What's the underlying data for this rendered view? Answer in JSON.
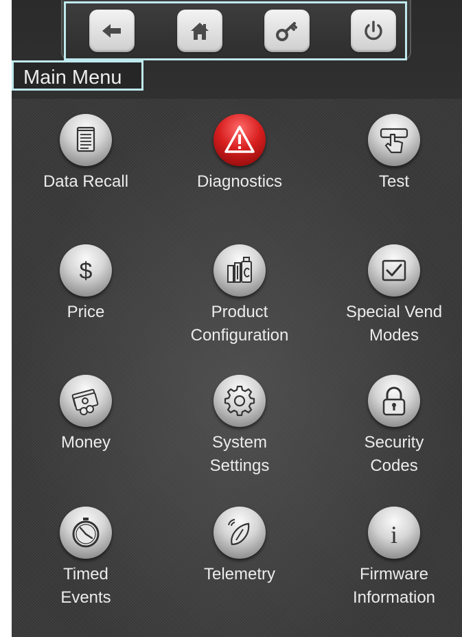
{
  "toolbar": {
    "buttons": [
      {
        "name": "back",
        "icon": "arrow-left-icon"
      },
      {
        "name": "home",
        "icon": "home-icon"
      },
      {
        "name": "key",
        "icon": "key-icon"
      },
      {
        "name": "power",
        "icon": "power-icon"
      }
    ]
  },
  "header": {
    "title": "Main Menu"
  },
  "menu": {
    "items": [
      {
        "icon": "notepad-icon",
        "lines": [
          "Data Recall"
        ]
      },
      {
        "icon": "warning-icon",
        "lines": [
          "Diagnostics"
        ]
      },
      {
        "icon": "hand-pointer-icon",
        "lines": [
          "Test"
        ]
      },
      {
        "icon": "dollar-icon",
        "lines": [
          "Price"
        ]
      },
      {
        "icon": "products-icon",
        "lines": [
          "Product",
          "Configuration"
        ]
      },
      {
        "icon": "checkbox-icon",
        "lines": [
          "Special Vend",
          "Modes"
        ]
      },
      {
        "icon": "money-icon",
        "lines": [
          "Money"
        ]
      },
      {
        "icon": "gear-icon",
        "lines": [
          "System",
          "Settings"
        ]
      },
      {
        "icon": "padlock-icon",
        "lines": [
          "Security",
          "Codes"
        ]
      },
      {
        "icon": "stopwatch-icon",
        "lines": [
          "Timed",
          "Events"
        ]
      },
      {
        "icon": "satellite-dish-icon",
        "lines": [
          "Telemetry"
        ]
      },
      {
        "icon": "info-icon",
        "lines": [
          "Firmware",
          "Information"
        ]
      }
    ]
  },
  "colors": {
    "highlight": "#bfe9ee",
    "diagnostics": "#d81f1f",
    "text": "#ececec"
  }
}
